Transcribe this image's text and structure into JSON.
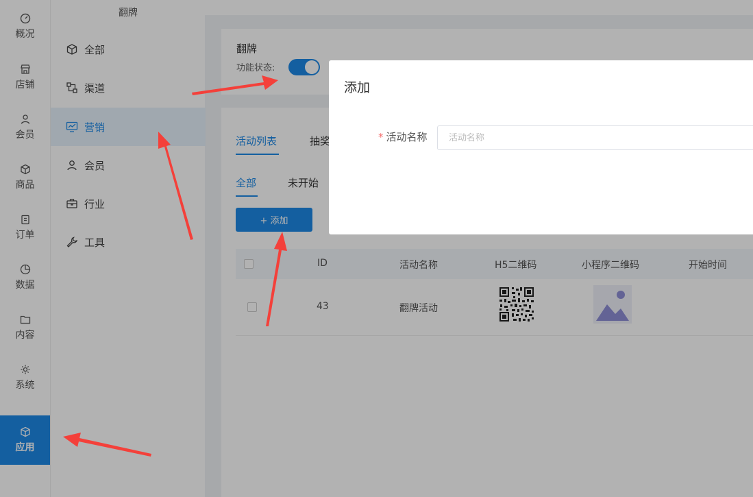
{
  "primary_nav": [
    {
      "label": "概况",
      "icon": "gauge-icon",
      "active": false
    },
    {
      "label": "店铺",
      "icon": "store-icon",
      "active": false
    },
    {
      "label": "会员",
      "icon": "user-icon",
      "active": false
    },
    {
      "label": "商品",
      "icon": "box-icon",
      "active": false
    },
    {
      "label": "订单",
      "icon": "clipboard-icon",
      "active": false
    },
    {
      "label": "数据",
      "icon": "pie-icon",
      "active": false
    },
    {
      "label": "内容",
      "icon": "folder-icon",
      "active": false
    },
    {
      "label": "系统",
      "icon": "gear-icon",
      "active": false
    },
    {
      "label": "应用",
      "icon": "cube-icon",
      "active": true
    }
  ],
  "secondary_nav": {
    "title": "翻牌",
    "items": [
      {
        "label": "全部",
        "icon": "cube-icon",
        "active": false
      },
      {
        "label": "渠道",
        "icon": "channel-icon",
        "active": false
      },
      {
        "label": "营销",
        "icon": "chart-monitor-icon",
        "active": true
      },
      {
        "label": "会员",
        "icon": "user-icon",
        "active": false
      },
      {
        "label": "行业",
        "icon": "briefcase-icon",
        "active": false
      },
      {
        "label": "工具",
        "icon": "wrench-icon",
        "active": false
      }
    ]
  },
  "feature": {
    "title": "翻牌",
    "status_label": "功能状态:",
    "enabled": true
  },
  "tabs": [
    "活动列表",
    "抽奖"
  ],
  "filter_tabs": [
    "全部",
    "未开始"
  ],
  "add_button": "+ 添加",
  "table": {
    "headers": [
      "ID",
      "活动名称",
      "H5二维码",
      "小程序二维码",
      "开始时间"
    ],
    "rows": [
      {
        "id": "43",
        "name": "翻牌活动"
      }
    ]
  },
  "modal": {
    "title": "添加",
    "field_label": "活动名称",
    "required_mark": "*",
    "field_placeholder": "活动名称"
  },
  "colors": {
    "accent": "#1e88e5",
    "annotation_arrow": "#f4403a"
  }
}
